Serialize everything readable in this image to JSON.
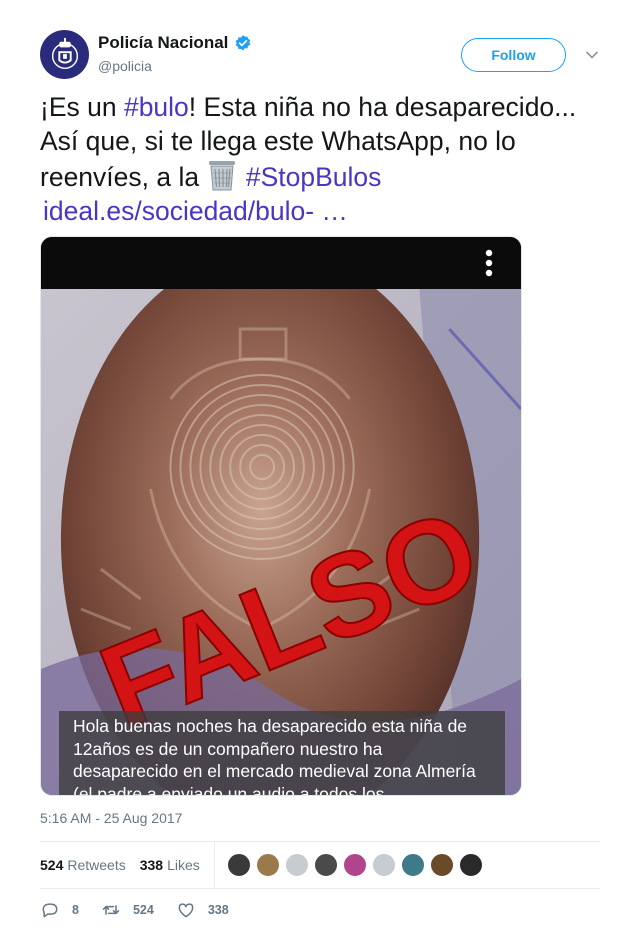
{
  "author": {
    "display_name": "Policía Nacional",
    "handle": "@policia",
    "verified": true
  },
  "follow_button": {
    "label": "Follow"
  },
  "tweet": {
    "text_1": "¡Es un ",
    "hashtag_1": "#bulo",
    "text_2": "! Esta niña no ha desaparecido... Así que, si te llega este WhatsApp, no lo reenvíes, a la ",
    "hashtag_2": "#StopBulos",
    "link": "ideal.es/sociedad/bulo- …"
  },
  "media": {
    "stamp_text": "FALSO",
    "caption": "Hola buenas noches ha desaparecido esta niña de 12años es de un compañero nuestro ha desaparecido en el mercado medieval zona Almería (el padre a enviado un audio a todos los"
  },
  "timestamp": "5:16 AM - 25 Aug 2017",
  "stats": {
    "retweets_count": "524",
    "retweets_label": "Retweets",
    "likes_count": "338",
    "likes_label": "Likes"
  },
  "likers": [
    {
      "color": "#3a3a3a"
    },
    {
      "color": "#9a7a4a"
    },
    {
      "color": "#c7ccd1"
    },
    {
      "color": "#4a4a4a"
    },
    {
      "color": "#b0458e"
    },
    {
      "color": "#c7ccd1"
    },
    {
      "color": "#3f7a8a"
    },
    {
      "color": "#6b4a2a"
    },
    {
      "color": "#2a2a2a"
    }
  ],
  "actions": {
    "replies": "8",
    "retweets": "524",
    "likes": "338"
  },
  "colors": {
    "link": "#4a35c5",
    "accent": "#1da1f2",
    "muted": "#657786",
    "stamp_red": "#d41414"
  },
  "icons": [
    "police-badge-icon",
    "verified-icon",
    "chevron-down-icon",
    "wastebasket-icon",
    "kebab-menu-icon",
    "reply-icon",
    "retweet-icon",
    "like-icon"
  ]
}
